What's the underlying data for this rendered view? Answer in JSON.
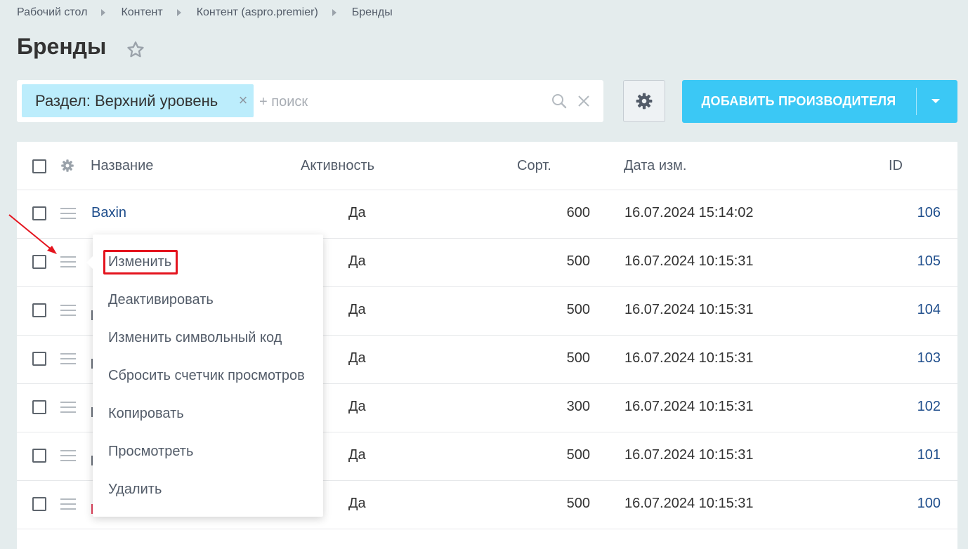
{
  "breadcrumbs": [
    "Рабочий стол",
    "Контент",
    "Контент (aspro.premier)",
    "Бренды"
  ],
  "page": {
    "title": "Бренды"
  },
  "filter": {
    "tag_label": "Раздел: Верхний уровень",
    "tag_remove": "×",
    "search_placeholder": "+ поиск"
  },
  "toolbar": {
    "add_label": "ДОБАВИТЬ ПРОИЗВОДИТЕЛЯ"
  },
  "grid": {
    "columns": {
      "name": "Название",
      "active": "Активность",
      "sort": "Сорт.",
      "date": "Дата изм.",
      "id": "ID"
    },
    "rows": [
      {
        "name": "Baxin",
        "active": "Да",
        "sort": "600",
        "date": "16.07.2024 15:14:02",
        "id": "106"
      },
      {
        "name": "",
        "active": "Да",
        "sort": "500",
        "date": "16.07.2024 10:15:31",
        "id": "105"
      },
      {
        "name": "",
        "active": "Да",
        "sort": "500",
        "date": "16.07.2024 10:15:31",
        "id": "104"
      },
      {
        "name": "",
        "active": "Да",
        "sort": "500",
        "date": "16.07.2024 10:15:31",
        "id": "103"
      },
      {
        "name": "",
        "active": "Да",
        "sort": "300",
        "date": "16.07.2024 10:15:31",
        "id": "102"
      },
      {
        "name": "",
        "active": "Да",
        "sort": "500",
        "date": "16.07.2024 10:15:31",
        "id": "101"
      },
      {
        "name": "",
        "active": "Да",
        "sort": "500",
        "date": "16.07.2024 10:15:31",
        "id": "100"
      }
    ]
  },
  "context_menu": {
    "items": [
      "Изменить",
      "Деактивировать",
      "Изменить символьный код",
      "Сбросить счетчик просмотров",
      "Копировать",
      "Просмотреть",
      "Удалить"
    ]
  },
  "colors": {
    "background": "#e4eced",
    "accent": "#3bc8f5",
    "link": "#1f4e8c",
    "tag": "#bcedfc",
    "highlight": "#e4141e"
  },
  "icons": {
    "favorite": "star-icon",
    "search": "search-icon",
    "clear": "close-icon",
    "settings": "gear-icon",
    "row_menu": "hamburger-icon",
    "dropdown": "caret-down-icon"
  }
}
